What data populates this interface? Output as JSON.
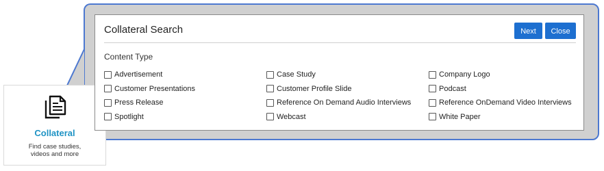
{
  "tile": {
    "icon": "document-copy-icon",
    "title": "Collateral",
    "subtitle_line1": "Find case studies,",
    "subtitle_line2": "videos and more"
  },
  "dialog": {
    "title": "Collateral Search",
    "next_label": "Next",
    "close_label": "Close",
    "section_label": "Content Type"
  },
  "options": [
    {
      "label": "Advertisement",
      "checked": false
    },
    {
      "label": "Case Study",
      "checked": false
    },
    {
      "label": "Company Logo",
      "checked": false
    },
    {
      "label": "Customer Presentations",
      "checked": false
    },
    {
      "label": "Customer Profile Slide",
      "checked": false
    },
    {
      "label": "Podcast",
      "checked": false
    },
    {
      "label": "Press Release",
      "checked": false
    },
    {
      "label": "Reference On Demand Audio Interviews",
      "checked": false
    },
    {
      "label": "Reference OnDemand Video Interviews",
      "checked": false
    },
    {
      "label": "Spotlight",
      "checked": false
    },
    {
      "label": "Webcast",
      "checked": false
    },
    {
      "label": "White Paper",
      "checked": false
    }
  ],
  "colors": {
    "accent": "#1d6fd0",
    "tile_title": "#1f93c4",
    "callout_border": "#4c78d0",
    "callout_fill": "#d0d0d0"
  }
}
